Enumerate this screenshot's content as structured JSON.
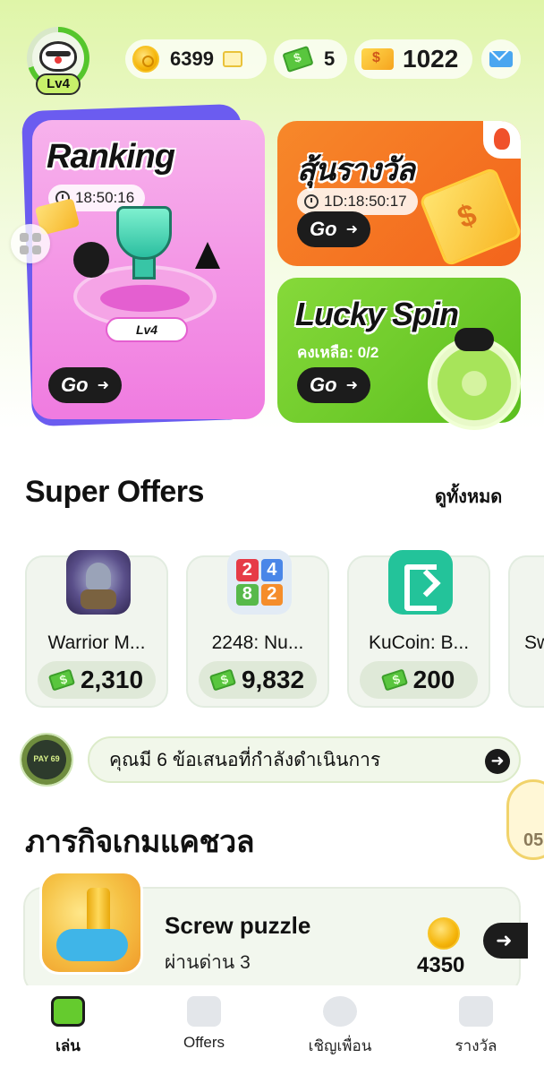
{
  "header": {
    "level": "Lv4",
    "coins": "6399",
    "cash": "5",
    "tickets": "1022"
  },
  "cards": {
    "ranking": {
      "title": "Ranking",
      "timer": "18:50:16",
      "level_label": "Lv4",
      "go_label": "Go"
    },
    "lucky_draw": {
      "title": "สุ้นรางวัล",
      "timer": "1D:18:50:17",
      "go_label": "Go"
    },
    "lucky_spin": {
      "title": "Lucky Spin",
      "remaining": "คงเหลือ: 0/2",
      "go_label": "Go"
    }
  },
  "super_offers": {
    "title": "Super Offers",
    "see_all": "ดูทั้งหมด",
    "items": [
      {
        "name": "Warrior M...",
        "reward": "2,310",
        "icon": "warrior-game-icon"
      },
      {
        "name": "2248: Nu...",
        "reward": "9,832",
        "icon": "number-tiles-icon",
        "tiles": [
          "2",
          "4",
          "8",
          "2"
        ]
      },
      {
        "name": "KuCoin: B...",
        "reward": "200",
        "icon": "kucoin-icon"
      },
      {
        "name": "Sw",
        "reward": "",
        "icon": ""
      }
    ]
  },
  "progress": {
    "avatar_text": "PAY 69",
    "message": "คุณมี 6 ข้อเสนอที่กำลังดำเนินการ"
  },
  "floating_badge": {
    "text": "05"
  },
  "casual": {
    "title": "ภารกิจเกมแคชวล",
    "game": {
      "title": "Screw puzzle",
      "subtitle": "ผ่านด่าน 3",
      "reward": "4350"
    }
  },
  "nav": {
    "items": [
      {
        "label": "เล่น",
        "active": true
      },
      {
        "label": "Offers",
        "active": false
      },
      {
        "label": "เชิญเพื่อน",
        "active": false
      },
      {
        "label": "รางวัล",
        "active": false
      }
    ]
  },
  "colors": {
    "accent_green": "#65cb2e",
    "ranking_pink": "#f07be0",
    "lucky_draw_orange": "#f3641c",
    "lucky_spin_green": "#5bbf1e"
  }
}
